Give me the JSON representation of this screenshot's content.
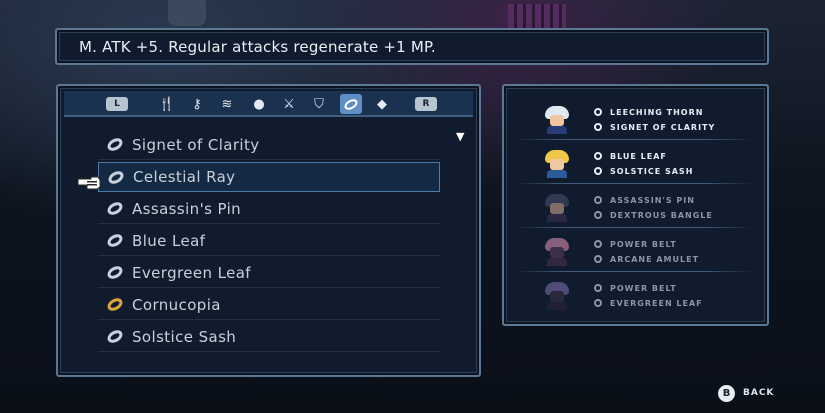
{
  "description": "M. ATK +5. Regular attacks regenerate +1 MP.",
  "tabs": [
    {
      "id": "bumper-left",
      "glyph": "L",
      "icon": "l-bumper-icon",
      "active": false
    },
    {
      "id": "utensils",
      "glyph": "🍴",
      "icon": "fork-icon",
      "active": false
    },
    {
      "id": "keys",
      "glyph": "⚷",
      "icon": "key-icon",
      "active": false
    },
    {
      "id": "scrolls",
      "glyph": "≋",
      "icon": "scroll-icon",
      "active": false
    },
    {
      "id": "consumables",
      "glyph": "●",
      "icon": "apple-icon",
      "active": false
    },
    {
      "id": "weapons",
      "glyph": "⚔",
      "icon": "sword-icon",
      "active": false
    },
    {
      "id": "armor",
      "glyph": "⛉",
      "icon": "shield-icon",
      "active": false
    },
    {
      "id": "accessories",
      "glyph": "",
      "icon": "ring-icon",
      "active": true
    },
    {
      "id": "gems",
      "glyph": "◆",
      "icon": "gem-icon",
      "active": false
    },
    {
      "id": "bumper-right",
      "glyph": "R",
      "icon": "r-bumper-icon",
      "active": false
    }
  ],
  "items": [
    {
      "label": "Signet of Clarity",
      "icon": "ring-icon",
      "selected": false
    },
    {
      "label": "Celestial Ray",
      "icon": "ring-icon",
      "selected": true
    },
    {
      "label": "Assassin's Pin",
      "icon": "ring-icon",
      "selected": false
    },
    {
      "label": "Blue Leaf",
      "icon": "ring-icon",
      "selected": false
    },
    {
      "label": "Evergreen Leaf",
      "icon": "ring-icon",
      "selected": false
    },
    {
      "label": "Cornucopia",
      "icon": "gold-ring-icon",
      "selected": false
    },
    {
      "label": "Solstice Sash",
      "icon": "ring-icon",
      "selected": false
    }
  ],
  "party": [
    {
      "portrait": "white-haired-character-portrait",
      "slot1": "Leeching Thorn",
      "slot2": "Signet of Clarity",
      "active": true,
      "hair": "#dfe9f2",
      "skin": "#f1c7a0",
      "outfit": "#2a3b7a"
    },
    {
      "portrait": "blonde-character-portrait",
      "slot1": "Blue Leaf",
      "slot2": "Solstice Sash",
      "active": true,
      "hair": "#f0c64b",
      "skin": "#f1c7a0",
      "outfit": "#2c5b9c"
    },
    {
      "portrait": "dark-hooded-character-portrait",
      "slot1": "Assassin's Pin",
      "slot2": "Dextrous Bangle",
      "active": false,
      "hair": "#4a4a6a",
      "skin": "#c9a58c",
      "outfit": "#3a2f4f"
    },
    {
      "portrait": "pink-masked-character-portrait",
      "slot1": "Power Belt",
      "slot2": "Arcane Amulet",
      "active": false,
      "hair": "#d88ab0",
      "skin": "#5a3d5c",
      "outfit": "#4a2f4c"
    },
    {
      "portrait": "purple-haired-character-portrait",
      "slot1": "Power Belt",
      "slot2": "Evergreen Leaf",
      "active": false,
      "hair": "#7a6ca8",
      "skin": "#3a3048",
      "outfit": "#2a2438"
    }
  ],
  "back": {
    "glyph": "B",
    "label": "BACK"
  }
}
